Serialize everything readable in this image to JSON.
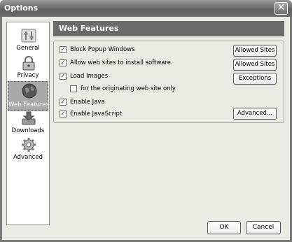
{
  "window": {
    "title": "Options",
    "close_glyph": "✕"
  },
  "sidebar": {
    "items": [
      {
        "label": "General",
        "icon": "general-icon",
        "selected": false
      },
      {
        "label": "Privacy",
        "icon": "lock-icon",
        "selected": false
      },
      {
        "label": "Web Features",
        "icon": "globe-icon",
        "selected": true
      },
      {
        "label": "Downloads",
        "icon": "downloads-icon",
        "selected": false
      },
      {
        "label": "Advanced",
        "icon": "gear-icon",
        "selected": false
      }
    ]
  },
  "panel": {
    "title": "Web Features",
    "options": [
      {
        "label": "Block Popup Windows",
        "checked": true
      },
      {
        "label": "Allow web sites to install software",
        "checked": true
      },
      {
        "label": "Load Images",
        "checked": true
      },
      {
        "label": "for the originating web site only",
        "checked": false
      },
      {
        "label": "Enable Java",
        "checked": true
      },
      {
        "label": "Enable JavaScript",
        "checked": true
      }
    ],
    "buttons": {
      "allowed_sites_popup": "Allowed Sites",
      "allowed_sites_install": "Allowed Sites",
      "exceptions": "Exceptions",
      "advanced": "Advanced..."
    }
  },
  "footer": {
    "ok": "OK",
    "cancel": "Cancel"
  },
  "check_glyph": "✓"
}
